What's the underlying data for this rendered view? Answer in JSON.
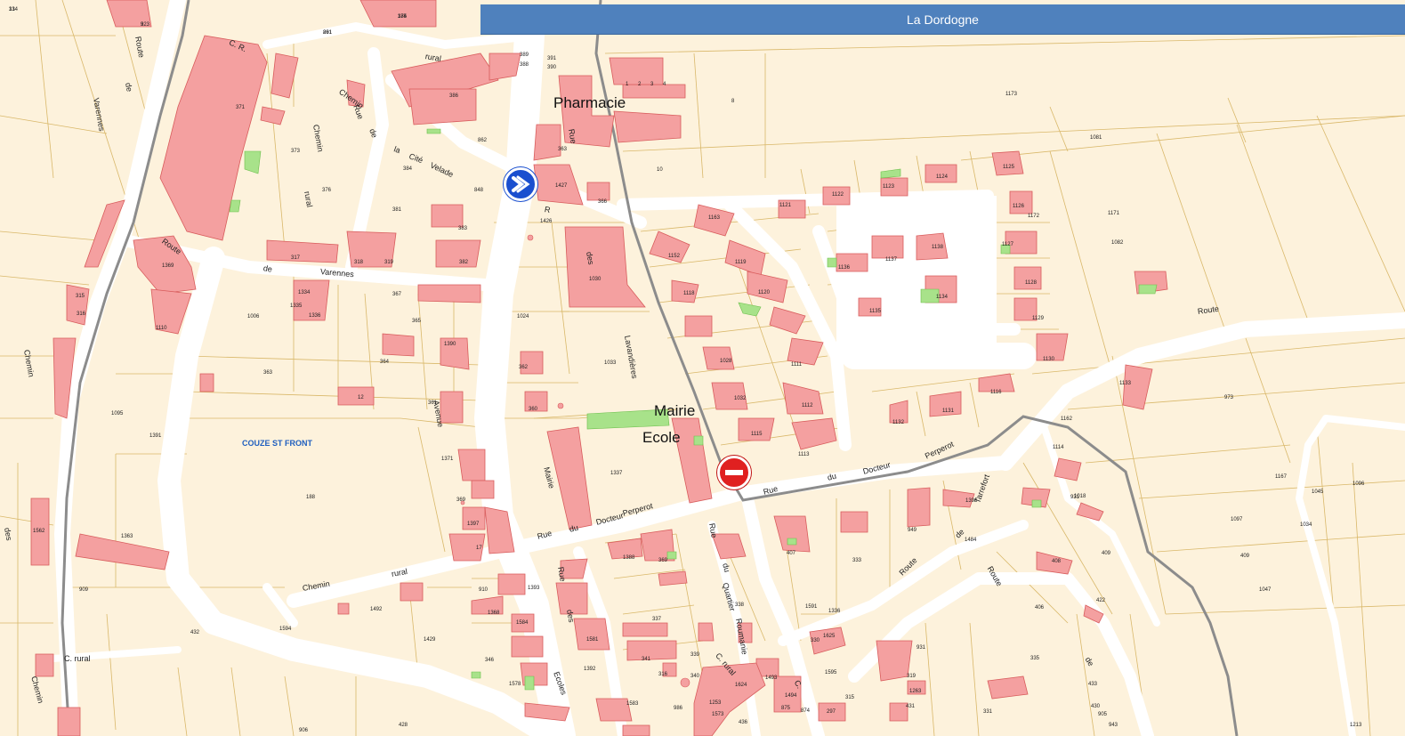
{
  "banner": {
    "title": "La Dordogne"
  },
  "poi": {
    "pharmacie": "Pharmacie",
    "mairie": "Mairie",
    "ecole": "Ecole"
  },
  "commune": "COUZE ST FRONT",
  "signs": {
    "direction": "direction-arrow-sign-icon",
    "no_entry": "no-entry-sign-icon"
  },
  "road_labels": {
    "route_varennes_1": "Route",
    "route_varennes_2": "de",
    "route_varennes_3": "Varennes",
    "cr": "C. R.",
    "chemin_1": "Chemin",
    "chemin_2": "Chemin",
    "chemin_3": "rural",
    "rue_cite_1": "Rue",
    "rue_cite_2": "de",
    "rue_cite_3": "la",
    "rue_cite_4": "Cité",
    "rue_cite_5": "Velade",
    "rural": "rural",
    "rue_lav_1": "Rue",
    "rue_lav_2": "R",
    "rue_lav_3": "des",
    "rue_lav_4": "Lavandières",
    "route_var_west": "Varennes",
    "route_var_west_de": "de",
    "route_var_west_route": "Route",
    "chemin_west": "Chemin",
    "des_west": "des",
    "avenue": "Avenue",
    "mairie_st": "Mairie",
    "rue_perpe_w1": "Rue",
    "rue_perpe_w2": "du",
    "rue_perpe_w3": "Docteur",
    "rue_perpe_w4": "Perperot",
    "rue_perpe_e1": "Rue",
    "rue_perpe_e2": "du",
    "rue_perpe_e3": "Docteur",
    "rue_perpe_e4": "Perperot",
    "chemin_rural_1": "Chemin",
    "chemin_rural_2": "rural",
    "rue_des_ecoles_1": "Rue",
    "rue_des_ecoles_2": "des",
    "rue_des_ecoles_3": "Ecoles",
    "rue_quartier_1": "Rue",
    "rue_quartier_2": "du",
    "rue_quartier_3": "Quartier",
    "roumanie": "Roumanie",
    "route_east": "Route",
    "route_tarrefort_1": "Route",
    "route_tarrefort_2": "de",
    "route_tarrefort_3": "Tarrefort",
    "route_se_1": "Route",
    "route_se_2": "de",
    "c_rural": "C. rural",
    "chemin_sw": "Chemin",
    "c_rural_s": "C. rural",
    "c_s": "C.",
    "varennes_nw": "Varennes",
    "de_nw": "de",
    "route_nw": "Route"
  },
  "parcel_numbers": [
    "13",
    "9",
    "374",
    "861",
    "389",
    "388",
    "391",
    "390",
    "1",
    "2",
    "3",
    "4",
    "8",
    "1173",
    "371",
    "373",
    "376",
    "386",
    "862",
    "363",
    "1427",
    "10",
    "1081",
    "1121",
    "1122",
    "1123",
    "1124",
    "1125",
    "384",
    "381",
    "848",
    "1426",
    "366",
    "1163",
    "1172",
    "1171",
    "1126",
    "1082",
    "1127",
    "1128",
    "1129",
    "1130",
    "1369",
    "317",
    "318",
    "319",
    "383",
    "382",
    "1152",
    "1119",
    "1136",
    "1137",
    "1138",
    "1134",
    "1135",
    "315",
    "316",
    "1334",
    "1335",
    "1336",
    "367",
    "365",
    "1006",
    "1030",
    "1024",
    "1120",
    "1118",
    "1110",
    "1390",
    "364",
    "363",
    "362",
    "1033",
    "1028",
    "1111",
    "1116",
    "1131",
    "1132",
    "1133",
    "973",
    "1162",
    "12",
    "361",
    "360",
    "1032",
    "1112",
    "1115",
    "1113",
    "1114",
    "1167",
    "1045",
    "1096",
    "1097",
    "1034",
    "1095",
    "1391",
    "1371",
    "369",
    "1337",
    "1396",
    "931",
    "409",
    "1047",
    "188",
    "1363",
    "1397",
    "1562",
    "17",
    "369",
    "1388",
    "333",
    "949",
    "1018",
    "409",
    "408",
    "406",
    "422",
    "407",
    "1591",
    "909",
    "910",
    "1368",
    "1584",
    "1393",
    "1492",
    "1484",
    "1336",
    "338",
    "330",
    "931",
    "1594",
    "432",
    "1429",
    "346",
    "1392",
    "341",
    "340",
    "337",
    "1595",
    "335",
    "331",
    "433",
    "1581",
    "1578",
    "1583",
    "316",
    "339",
    "1625",
    "1624",
    "1493",
    "1494",
    "315",
    "319",
    "1263",
    "431",
    "430",
    "905",
    "428",
    "906",
    "875",
    "874",
    "297",
    "986",
    "1253",
    "1573",
    "436",
    "1213",
    "943",
    "314",
    "323",
    "185",
    "291"
  ]
}
